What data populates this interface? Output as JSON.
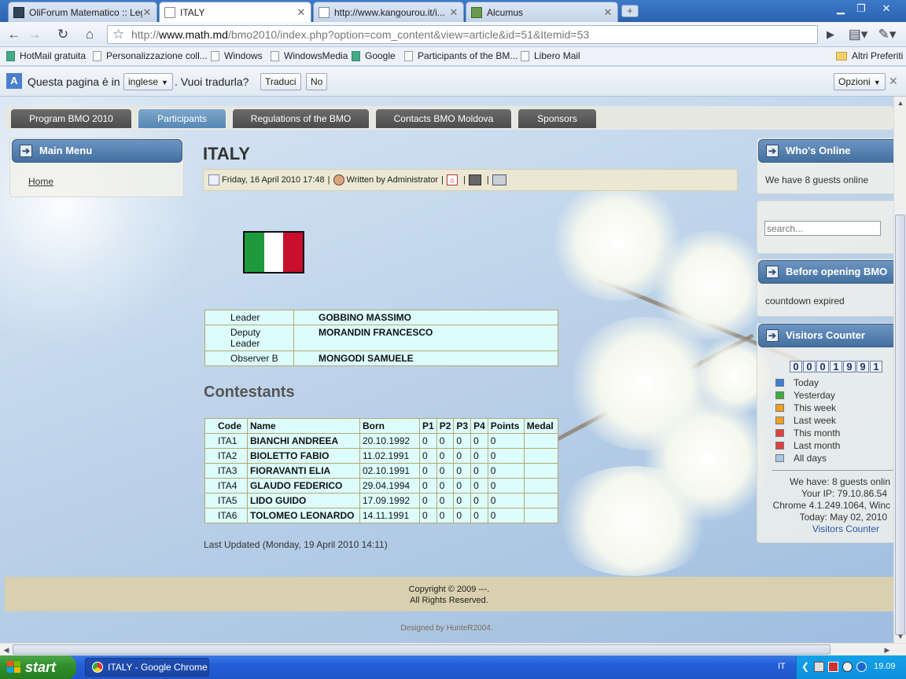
{
  "browser": {
    "tabs": [
      {
        "title": "OliForum Matematico :: Leg...",
        "active": false,
        "icon": "forum-icon"
      },
      {
        "title": "ITALY",
        "active": true,
        "icon": "page-icon"
      },
      {
        "title": "http://www.kangourou.it/i...",
        "active": false,
        "icon": "page-icon"
      },
      {
        "title": "Alcumus",
        "active": false,
        "icon": "cube-icon"
      }
    ],
    "url_host": "www.math.md",
    "url_prefix": "http://",
    "url_path": "/bmo2010/index.php?option=com_content&view=article&id=51&Itemid=53",
    "bookmarks": [
      "HotMail gratuita",
      "Personalizzazione coll...",
      "Windows",
      "WindowsMedia",
      "Google",
      "Participants of the BM...",
      "Libero Mail"
    ],
    "other_bookmarks": "Altri Preferiti"
  },
  "translate": {
    "text1": "Questa pagina è in",
    "language": "inglese",
    "text2": ". Vuoi tradurla?",
    "translate_button": "Traduci",
    "no_button": "No",
    "options_button": "Opzioni"
  },
  "site": {
    "menu": [
      "Program BMO 2010",
      "Participants",
      "Regulations of the BMO",
      "Contacts BMO Moldova",
      "Sponsors"
    ],
    "active_menu": "Participants",
    "left_module": {
      "title": "Main Menu",
      "link": "Home"
    },
    "article": {
      "title": "ITALY",
      "date": "Friday, 16 April 2010 17:48",
      "author": "Written by Administrator",
      "flag_colors": [
        "#1e9a3c",
        "#ffffff",
        "#c8102e"
      ],
      "team": [
        {
          "role": "Leader",
          "name": "GOBBINO MASSIMO"
        },
        {
          "role": "Deputy Leader",
          "name": "MORANDIN FRANCESCO"
        },
        {
          "role": "Observer B",
          "name": "MONGODI SAMUELE"
        }
      ],
      "contestants_heading": "Contestants",
      "columns": [
        "Code",
        "Name",
        "Born",
        "P1",
        "P2",
        "P3",
        "P4",
        "Points",
        "Medal"
      ],
      "rows": [
        [
          "ITA1",
          "BIANCHI ANDREEA",
          "20.10.1992",
          "0",
          "0",
          "0",
          "0",
          "0",
          ""
        ],
        [
          "ITA2",
          "BIOLETTO FABIO",
          "11.02.1991",
          "0",
          "0",
          "0",
          "0",
          "0",
          ""
        ],
        [
          "ITA3",
          "FIORAVANTI ELIA",
          "02.10.1991",
          "0",
          "0",
          "0",
          "0",
          "0",
          ""
        ],
        [
          "ITA4",
          "GLAUDO FEDERICO",
          "29.04.1994",
          "0",
          "0",
          "0",
          "0",
          "0",
          ""
        ],
        [
          "ITA5",
          "LIDO GUIDO",
          "17.09.1992",
          "0",
          "0",
          "0",
          "0",
          "0",
          ""
        ],
        [
          "ITA6",
          "TOLOMEO LEONARDO",
          "14.11.1991",
          "0",
          "0",
          "0",
          "0",
          "0",
          ""
        ]
      ],
      "last_updated": "Last Updated (Monday, 19 April 2010 14:11)"
    },
    "right": {
      "whos_online_title": "Who's Online",
      "whos_online_text": "We have 8 guests online",
      "search_placeholder": "search...",
      "before_title": "Before opening BMO",
      "before_text": "countdown expired",
      "visitors_title": "Visitors Counter",
      "counter_digits": [
        "0",
        "0",
        "0",
        "1",
        "9",
        "9",
        "1"
      ],
      "stats": [
        {
          "label": "Today",
          "color": "#3b7fd6"
        },
        {
          "label": "Yesterday",
          "color": "#3daa3d"
        },
        {
          "label": "This week",
          "color": "#f0a020"
        },
        {
          "label": "Last week",
          "color": "#f0a020"
        },
        {
          "label": "This month",
          "color": "#e04040"
        },
        {
          "label": "Last month",
          "color": "#e04040"
        },
        {
          "label": "All days",
          "color": "#a8c6e8"
        }
      ],
      "we_have": "We have: 8 guests onlin",
      "your_ip": "Your IP: 79.10.86.54",
      "browser_info": "Chrome 4.1.249.1064, Winc",
      "today": "Today: May 02, 2010",
      "counter_link": "Visitors Counter"
    },
    "footer": {
      "copyright": "Copyright © 2009 ---.",
      "rights": "All Rights Reserved.",
      "designed_by": "Designed by HunteR2004."
    }
  },
  "taskbar": {
    "start": "start",
    "window_item": "ITALY - Google Chrome",
    "lang": "IT",
    "clock": "19.09"
  }
}
